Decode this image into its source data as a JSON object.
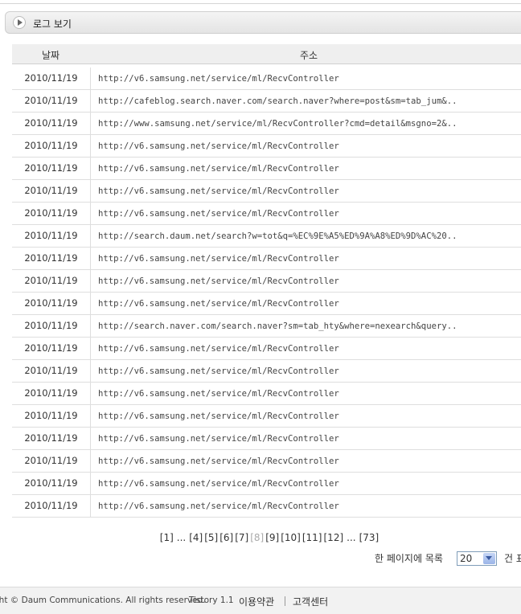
{
  "panel": {
    "title": "로그 보기"
  },
  "table": {
    "headers": {
      "date": "날짜",
      "address": "주소"
    },
    "rows": [
      {
        "date": "2010/11/19",
        "url": "http://v6.samsung.net/service/ml/RecvController"
      },
      {
        "date": "2010/11/19",
        "url": "http://cafeblog.search.naver.com/search.naver?where=post&sm=tab_jum&.."
      },
      {
        "date": "2010/11/19",
        "url": "http://www.samsung.net/service/ml/RecvController?cmd=detail&msgno=2&.."
      },
      {
        "date": "2010/11/19",
        "url": "http://v6.samsung.net/service/ml/RecvController"
      },
      {
        "date": "2010/11/19",
        "url": "http://v6.samsung.net/service/ml/RecvController"
      },
      {
        "date": "2010/11/19",
        "url": "http://v6.samsung.net/service/ml/RecvController"
      },
      {
        "date": "2010/11/19",
        "url": "http://v6.samsung.net/service/ml/RecvController"
      },
      {
        "date": "2010/11/19",
        "url": "http://search.daum.net/search?w=tot&q=%EC%9E%A5%ED%9A%A8%ED%9D%AC%20.."
      },
      {
        "date": "2010/11/19",
        "url": "http://v6.samsung.net/service/ml/RecvController"
      },
      {
        "date": "2010/11/19",
        "url": "http://v6.samsung.net/service/ml/RecvController"
      },
      {
        "date": "2010/11/19",
        "url": "http://v6.samsung.net/service/ml/RecvController"
      },
      {
        "date": "2010/11/19",
        "url": "http://search.naver.com/search.naver?sm=tab_hty&where=nexearch&query.."
      },
      {
        "date": "2010/11/19",
        "url": "http://v6.samsung.net/service/ml/RecvController"
      },
      {
        "date": "2010/11/19",
        "url": "http://v6.samsung.net/service/ml/RecvController"
      },
      {
        "date": "2010/11/19",
        "url": "http://v6.samsung.net/service/ml/RecvController"
      },
      {
        "date": "2010/11/19",
        "url": "http://v6.samsung.net/service/ml/RecvController"
      },
      {
        "date": "2010/11/19",
        "url": "http://v6.samsung.net/service/ml/RecvController"
      },
      {
        "date": "2010/11/19",
        "url": "http://v6.samsung.net/service/ml/RecvController"
      },
      {
        "date": "2010/11/19",
        "url": "http://v6.samsung.net/service/ml/RecvController"
      },
      {
        "date": "2010/11/19",
        "url": "http://v6.samsung.net/service/ml/RecvController"
      }
    ]
  },
  "pagination": {
    "first": "[1]",
    "ellipsis_left": "...",
    "pages": [
      "[4]",
      "[5]",
      "[6]",
      "[7]",
      "[8]",
      "[9]",
      "[10]",
      "[11]",
      "[12]"
    ],
    "current_index": 4,
    "ellipsis_right": "...",
    "last": "[73]"
  },
  "per_page": {
    "label": "한 페이지에 목록",
    "value": "20",
    "suffix": "건 표"
  },
  "footer": {
    "copyright": "ght © Daum Communications. All rights reserved.",
    "version": "Tistory 1.1",
    "terms": "이용약관",
    "support": "고객센터"
  }
}
